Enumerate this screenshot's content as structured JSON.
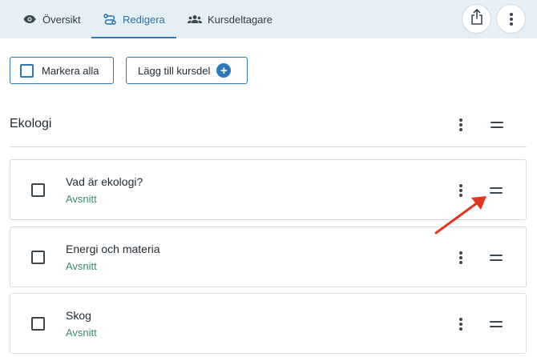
{
  "tabs": [
    {
      "label": "Översikt",
      "icon": "eye-icon",
      "active": false
    },
    {
      "label": "Redigera",
      "icon": "edit-flow-icon",
      "active": true
    },
    {
      "label": "Kursdeltagare",
      "icon": "people-icon",
      "active": false
    }
  ],
  "header_actions": {
    "share_icon": "share-icon",
    "more_icon": "more-vertical-icon"
  },
  "toolbar": {
    "select_all_label": "Markera alla",
    "add_part_label": "Lägg till kursdel",
    "add_icon": "plus-circle-icon"
  },
  "section": {
    "title": "Ekologi"
  },
  "items": [
    {
      "title": "Vad är ekologi?",
      "type": "Avsnitt"
    },
    {
      "title": "Energi och materia",
      "type": "Avsnitt"
    },
    {
      "title": "Skog",
      "type": "Avsnitt"
    }
  ],
  "colors": {
    "accent": "#2f78b3",
    "subtitle": "#3f8a6a",
    "annotation_arrow": "#e0351f",
    "topbar": "#e5eff6"
  }
}
